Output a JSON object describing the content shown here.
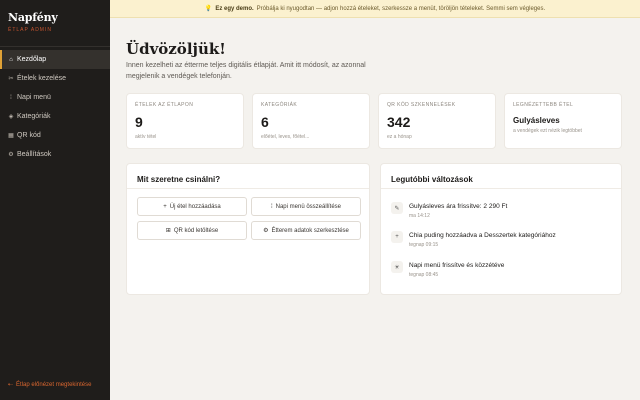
{
  "sidebar": {
    "brand_name": "Napfény",
    "brand_sub": "ÉTLAP ADMIN",
    "items": [
      {
        "icon": "⌂",
        "icon_name": "home-icon",
        "label": "Kezdőlap",
        "active": true
      },
      {
        "icon": "✂",
        "icon_name": "utensils-icon",
        "label": "Ételek kezelése"
      },
      {
        "icon": "⁞",
        "icon_name": "menu-icon",
        "label": "Napi menü"
      },
      {
        "icon": "◈",
        "icon_name": "tag-icon",
        "label": "Kategóriák"
      },
      {
        "icon": "▦",
        "icon_name": "qr-icon",
        "label": "QR kód"
      },
      {
        "icon": "⚙",
        "icon_name": "gear-icon",
        "label": "Beállítások"
      }
    ],
    "preview_icon": "⇠",
    "preview_label": "Étlap előnézet megtekintése"
  },
  "banner": {
    "icon": "💡",
    "bold": "Ez egy demo.",
    "text": "Próbálja ki nyugodtan — adjon hozzá ételeket, szerkessze a menüt, töröljön tételeket. Semmi sem végleges."
  },
  "page": {
    "title": "Üdvözöljük!",
    "intro": "Innen kezelheti az étterme teljes digitális étlapját. Amit itt módosít, az azonnal megjelenik a vendégek telefonján."
  },
  "stats": [
    {
      "label": "ÉTELEK AZ ÉTLAPON",
      "value": "9",
      "sub": "aktív tétel"
    },
    {
      "label": "KATEGÓRIÁK",
      "value": "6",
      "sub": "előétel, leves, főétel..."
    },
    {
      "label": "QR KÓD SZKENNELÉSEK",
      "value": "342",
      "sub": "ez a hónap"
    },
    {
      "label": "LEGNÉZETTEBB ÉTEL",
      "value": "Gulyásleves",
      "sub": "a vendégek ezt nézik legtöbbet"
    }
  ],
  "actions": {
    "title": "Mit szeretne csinálni?",
    "buttons": [
      {
        "icon": "+",
        "label": "Új étel hozzáadása"
      },
      {
        "icon": "⁞",
        "label": "Napi menü összeállítése"
      },
      {
        "icon": "⊞",
        "label": "QR kód letöltése"
      },
      {
        "icon": "⚙",
        "label": "Étterem adatok szerkesztése"
      }
    ]
  },
  "activity": {
    "title": "Legutóbbi változások",
    "items": [
      {
        "icon": "✎",
        "text": "Gulyásleves ára frissítve: 2 290 Ft",
        "time": "ma 14:12"
      },
      {
        "icon": "+",
        "text": "Chia puding hozzáadva a Desszertek kategóriához",
        "time": "tegnap 09:15"
      },
      {
        "icon": "☀",
        "text": "Napi menü frissítve és közzétéve",
        "time": "tegnap 08:45"
      }
    ]
  },
  "colors": {
    "accent": "#e0a236",
    "link": "#d9662f",
    "sidebar_bg": "#1f1d1b",
    "banner_bg": "#fbf1cf"
  }
}
